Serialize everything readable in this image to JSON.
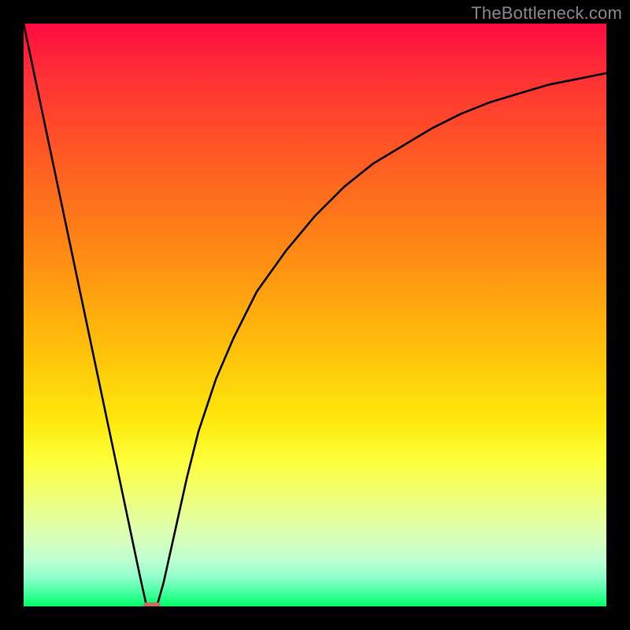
{
  "watermark": "TheBottleneck.com",
  "colors": {
    "frame": "#000000",
    "curve_stroke": "#000000",
    "marker_fill": "#cc6e5f",
    "gradient_stops": [
      {
        "pos": 0,
        "hex": "#ff0a42"
      },
      {
        "pos": 8,
        "hex": "#ff2d36"
      },
      {
        "pos": 22,
        "hex": "#ff5825"
      },
      {
        "pos": 40,
        "hex": "#ff8c13"
      },
      {
        "pos": 55,
        "hex": "#ffbe0a"
      },
      {
        "pos": 68,
        "hex": "#ffe80c"
      },
      {
        "pos": 75,
        "hex": "#fdff3a"
      },
      {
        "pos": 80,
        "hex": "#f2ff6c"
      },
      {
        "pos": 87,
        "hex": "#deffb0"
      },
      {
        "pos": 92,
        "hex": "#bfffd0"
      },
      {
        "pos": 95,
        "hex": "#90ffcc"
      },
      {
        "pos": 98,
        "hex": "#3cff98"
      },
      {
        "pos": 100,
        "hex": "#00ff6a"
      }
    ]
  },
  "chart_data": {
    "type": "line",
    "title": "",
    "xlabel": "",
    "ylabel": "",
    "xlim": [
      0,
      100
    ],
    "ylim": [
      0,
      100
    ],
    "series": [
      {
        "name": "bottleneck-curve",
        "x": [
          0,
          2,
          4,
          6,
          8,
          10,
          12,
          14,
          16,
          18,
          20,
          21,
          22,
          23,
          24,
          26,
          28,
          30,
          33,
          36,
          40,
          45,
          50,
          55,
          60,
          65,
          70,
          75,
          80,
          85,
          90,
          95,
          100
        ],
        "y": [
          100,
          90.5,
          81,
          71.5,
          62,
          52.5,
          43,
          33.5,
          24,
          14.5,
          5,
          0.5,
          0,
          0.5,
          4,
          13,
          22,
          30,
          39,
          46,
          54,
          61,
          67,
          72,
          76,
          79,
          82,
          84.5,
          86.5,
          88,
          89.5,
          90.5,
          91.5
        ]
      }
    ],
    "marker": {
      "x": 22,
      "y": 0,
      "shape": "rounded-rect",
      "color": "#cc6e5f"
    }
  }
}
